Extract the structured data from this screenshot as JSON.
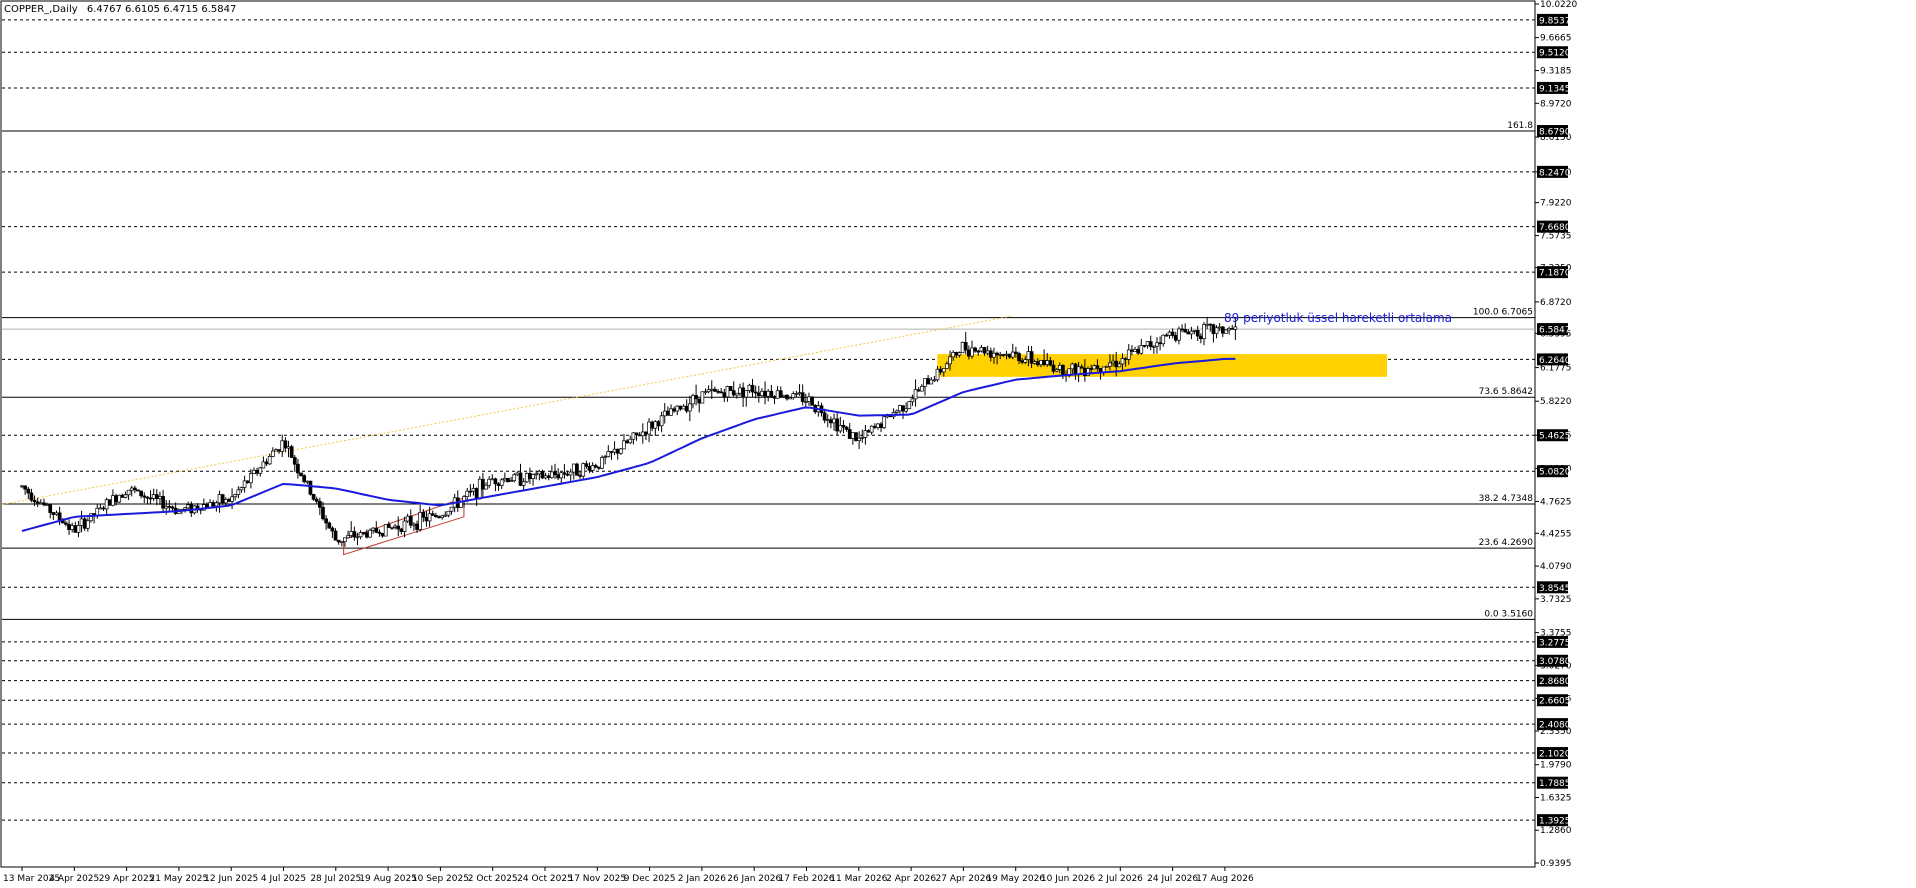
{
  "header": {
    "symbol_title": "COPPER_,Daily",
    "ohlc_values": "6.4767 6.6105 6.4715 6.5847"
  },
  "annotations": {
    "ema_label": "89 periyotluk üssel hareketli ortalama"
  },
  "colors": {
    "background": "#ffffff",
    "candle": "#000000",
    "ema": "#1a1adc",
    "zone": "#ffd100",
    "channel": "#c0392b",
    "trendline": "#f4c542",
    "tag_bg": "#000000",
    "tag_text": "#ffffff"
  },
  "chart_data": {
    "type": "candlestick",
    "instrument": "COPPER_",
    "timeframe": "Daily",
    "ylim": [
      0.9395,
      10.022
    ],
    "x_tick_labels": [
      "13 Mar 2025",
      "4 Apr 2025",
      "29 Apr 2025",
      "21 May 2025",
      "12 Jun 2025",
      "4 Jul 2025",
      "28 Jul 2025",
      "19 Aug 2025",
      "10 Sep 2025",
      "2 Oct 2025",
      "24 Oct 2025",
      "17 Nov 2025",
      "9 Dec 2025",
      "2 Jan 2026",
      "26 Jan 2026",
      "17 Feb 2026",
      "11 Mar 2026",
      "2 Apr 2026",
      "27 Apr 2026",
      "19 May 2026",
      "10 Jun 2026",
      "2 Jul 2026",
      "24 Jul 2026",
      "17 Aug 2026"
    ],
    "y_tick_labels": [
      "10.0220",
      "9.6665",
      "9.3185",
      "8.9720",
      "8.6150",
      "8.2470",
      "7.9220",
      "7.5735",
      "7.2350",
      "6.8720",
      "6.5395",
      "6.1775",
      "5.8220",
      "5.4625",
      "5.1120",
      "4.7625",
      "4.4255",
      "4.0790",
      "3.7325",
      "3.3755",
      "3.0270",
      "2.6805",
      "2.3350",
      "1.9790",
      "1.6325",
      "1.2860",
      "0.9395"
    ],
    "price_tags": [
      "9.8537",
      "9.5120",
      "9.1345",
      "8.6790",
      "8.2470",
      "7.6680",
      "7.1870",
      "6.5847",
      "6.2640",
      "5.4625",
      "5.0820",
      "3.8545",
      "3.2775",
      "3.0780",
      "2.8680",
      "2.6605",
      "2.4080",
      "2.1020",
      "1.7885",
      "1.3925"
    ],
    "current_price": 6.5847,
    "dashed_levels": [
      9.8537,
      9.512,
      9.1345,
      8.679,
      8.247,
      7.668,
      7.187,
      6.264,
      5.4625,
      5.082,
      3.8545,
      3.2775,
      3.078,
      2.868,
      2.6605,
      2.408,
      2.102,
      1.7885,
      1.3925
    ],
    "fibonacci": [
      {
        "label": "161.8",
        "value": 8.679
      },
      {
        "label": "100.0 6.7065",
        "value": 6.7065
      },
      {
        "label": "73.6 5.8642",
        "value": 5.8642
      },
      {
        "label": "38.2 4.7348",
        "value": 4.7348
      },
      {
        "label": "23.6 4.2690",
        "value": 4.269
      },
      {
        "label": "0.0 3.5160",
        "value": 3.516
      }
    ],
    "support_zone": {
      "from": 6.08,
      "to": 6.32
    },
    "price_path": [
      [
        "13 Mar 2025",
        4.92
      ],
      [
        "4 Apr 2025",
        4.45
      ],
      [
        "29 Apr 2025",
        4.9
      ],
      [
        "21 May 2025",
        4.67
      ],
      [
        "12 Jun 2025",
        4.78
      ],
      [
        "4 Jul 2025",
        5.4
      ],
      [
        "28 Jul 2025",
        4.35
      ],
      [
        "19 Aug 2025",
        4.48
      ],
      [
        "10 Sep 2025",
        4.62
      ],
      [
        "2 Oct 2025",
        5.0
      ],
      [
        "24 Oct 2025",
        5.02
      ],
      [
        "17 Nov 2025",
        5.15
      ],
      [
        "9 Dec 2025",
        5.55
      ],
      [
        "2 Jan 2026",
        5.9
      ],
      [
        "26 Jan 2026",
        5.95
      ],
      [
        "17 Feb 2026",
        5.85
      ],
      [
        "11 Mar 2026",
        5.4
      ],
      [
        "2 Apr 2026",
        5.85
      ],
      [
        "27 Apr 2026",
        6.4
      ],
      [
        "19 May 2026",
        6.3
      ],
      [
        "10 Jun 2026",
        6.15
      ],
      [
        "2 Jul 2026",
        6.25
      ],
      [
        "24 Jul 2026",
        6.55
      ],
      [
        "17 Aug 2026",
        6.58
      ]
    ],
    "ema_89": [
      [
        "13 Mar 2025",
        4.45
      ],
      [
        "4 Apr 2025",
        4.6
      ],
      [
        "29 Apr 2025",
        4.63
      ],
      [
        "21 May 2025",
        4.66
      ],
      [
        "12 Jun 2025",
        4.72
      ],
      [
        "4 Jul 2025",
        4.95
      ],
      [
        "28 Jul 2025",
        4.9
      ],
      [
        "19 Aug 2025",
        4.78
      ],
      [
        "10 Sep 2025",
        4.72
      ],
      [
        "2 Oct 2025",
        4.82
      ],
      [
        "24 Oct 2025",
        4.92
      ],
      [
        "17 Nov 2025",
        5.02
      ],
      [
        "9 Dec 2025",
        5.17
      ],
      [
        "2 Jan 2026",
        5.43
      ],
      [
        "26 Jan 2026",
        5.63
      ],
      [
        "17 Feb 2026",
        5.76
      ],
      [
        "11 Mar 2026",
        5.67
      ],
      [
        "2 Apr 2026",
        5.68
      ],
      [
        "27 Apr 2026",
        5.92
      ],
      [
        "19 May 2026",
        6.05
      ],
      [
        "10 Jun 2026",
        6.1
      ],
      [
        "2 Jul 2026",
        6.14
      ],
      [
        "24 Jul 2026",
        6.22
      ],
      [
        "17 Aug 2026",
        6.27
      ]
    ]
  }
}
